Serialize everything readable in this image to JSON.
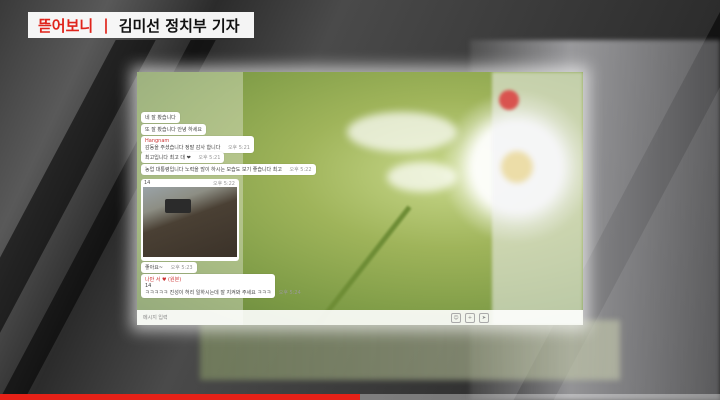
{
  "caption": {
    "tag": "뜯어보니",
    "separator": "|",
    "reporter": "김미선 정치부 기자"
  },
  "chat": {
    "messages": [
      {
        "name": "",
        "text": "네 잘 봤습니다",
        "time": ""
      },
      {
        "name": "",
        "text": "또 잘 봤습니다 안녕 하세요",
        "time": ""
      },
      {
        "name": "Hangnam",
        "text": "감동을 주셨습니다 정말 감사 합니다",
        "time": "오후 5:21"
      },
      {
        "name": "",
        "text": "최고입니다 최고 대 ❤",
        "time": "오후 5:21"
      },
      {
        "name": "",
        "text": "농업 대통령입니다 노력을 많이 하시는 모습도 보기 좋습니다 최고",
        "time": "오후 5:22"
      },
      {
        "name": "",
        "text": "좋아요~",
        "time": "오후 5:23"
      }
    ],
    "photo_card": {
      "title": "14",
      "time": "오후 5:22"
    },
    "quoted": {
      "name": "나만 서 ♥ (원본)",
      "ref": "14",
      "text": "ㅋㅋㅋㅋㅋ 진성이 허리 일하시는데 잘 지켜봐 주세요 ㅋㅋㅋ",
      "time": "오후 5:24"
    },
    "input_placeholder": "메시지 입력",
    "icons": [
      "emoticon-icon",
      "attach-icon",
      "send-icon"
    ]
  },
  "video": {
    "progress": 0.5
  },
  "colors": {
    "accent": "#e0241b",
    "progress": "#e62117"
  }
}
